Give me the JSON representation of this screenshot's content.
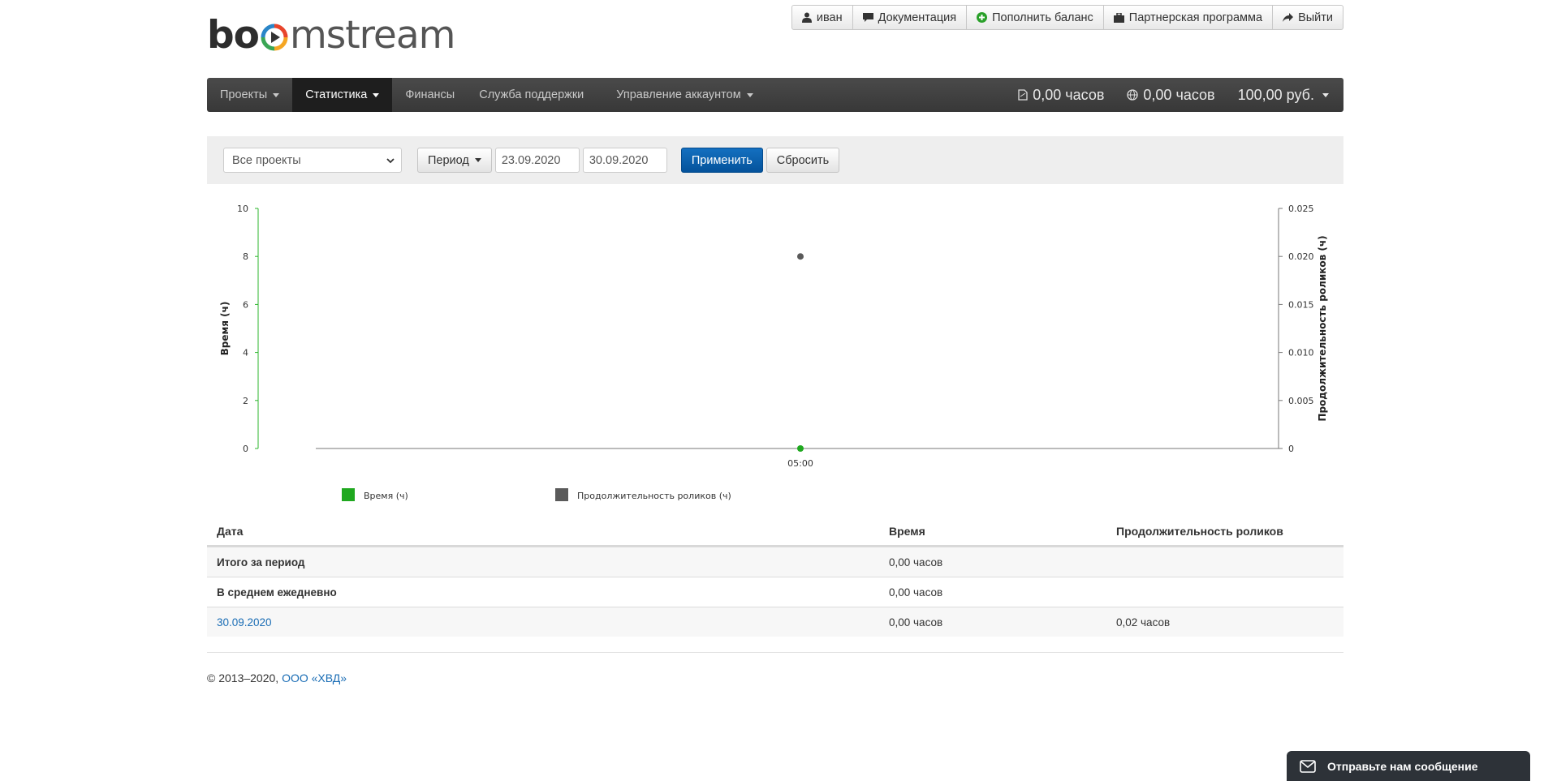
{
  "logo": {
    "part1": "bo",
    "part2": "mstream"
  },
  "topbar": {
    "items": [
      {
        "label": "иван",
        "icon": "user-icon"
      },
      {
        "label": "Документация",
        "icon": "comment-icon"
      },
      {
        "label": "Пополнить баланс",
        "icon": "plus-circle-icon"
      },
      {
        "label": "Партнерская программа",
        "icon": "briefcase-icon"
      },
      {
        "label": "Выйти",
        "icon": "share-arrow-icon"
      }
    ]
  },
  "navbar": {
    "items": [
      {
        "label": "Проекты",
        "dropdown": true
      },
      {
        "label": "Статистика",
        "dropdown": true,
        "active": true
      },
      {
        "label": "Финансы"
      },
      {
        "label": "Служба поддержки"
      },
      {
        "label": "Управление аккаунтом",
        "dropdown": true
      }
    ],
    "stats": {
      "hours1": "0,00 часов",
      "hours2": "0,00 часов",
      "balance": "100,00 руб."
    }
  },
  "filters": {
    "project_select": "Все проекты",
    "period_button": "Период",
    "date_from": "23.09.2020",
    "date_to": "30.09.2020",
    "apply": "Применить",
    "reset": "Сбросить"
  },
  "chart_data": {
    "type": "scatter",
    "x_ticks": [
      "05:00"
    ],
    "ylabel_left": "Время (ч)",
    "ylabel_right": "Продолжительность роликов (ч)",
    "yleft_ticks": [
      "0",
      "2",
      "4",
      "6",
      "8",
      "10"
    ],
    "yright_ticks": [
      "0",
      "0.005",
      "0.010",
      "0.015",
      "0.020",
      "0.025"
    ],
    "ylim_left": [
      0,
      10
    ],
    "ylim_right": [
      0,
      0.025
    ],
    "series": [
      {
        "name": "Время (ч)",
        "color": "#1fa81f",
        "axis": "left",
        "points": [
          {
            "x": "05:00",
            "y": 0
          }
        ]
      },
      {
        "name": "Продолжительность роликов (ч)",
        "color": "#5a5a5a",
        "axis": "right",
        "points": [
          {
            "x": "05:00",
            "y": 0.02
          }
        ]
      }
    ],
    "legend_position": "bottom-left"
  },
  "table": {
    "headers": [
      "Дата",
      "Время",
      "Продолжительность роликов"
    ],
    "rows": [
      {
        "date": "Итого за период",
        "time": "0,00 часов",
        "duration": ""
      },
      {
        "date": "В среднем ежедневно",
        "time": "0,00 часов",
        "duration": ""
      },
      {
        "date": "30.09.2020",
        "time": "0,00 часов",
        "duration": "0,02 часов"
      }
    ]
  },
  "footer": {
    "copyright": "© 2013–2020,",
    "company": "ООО «ХВД»"
  },
  "chat": {
    "label": "Отправьте нам сообщение"
  }
}
